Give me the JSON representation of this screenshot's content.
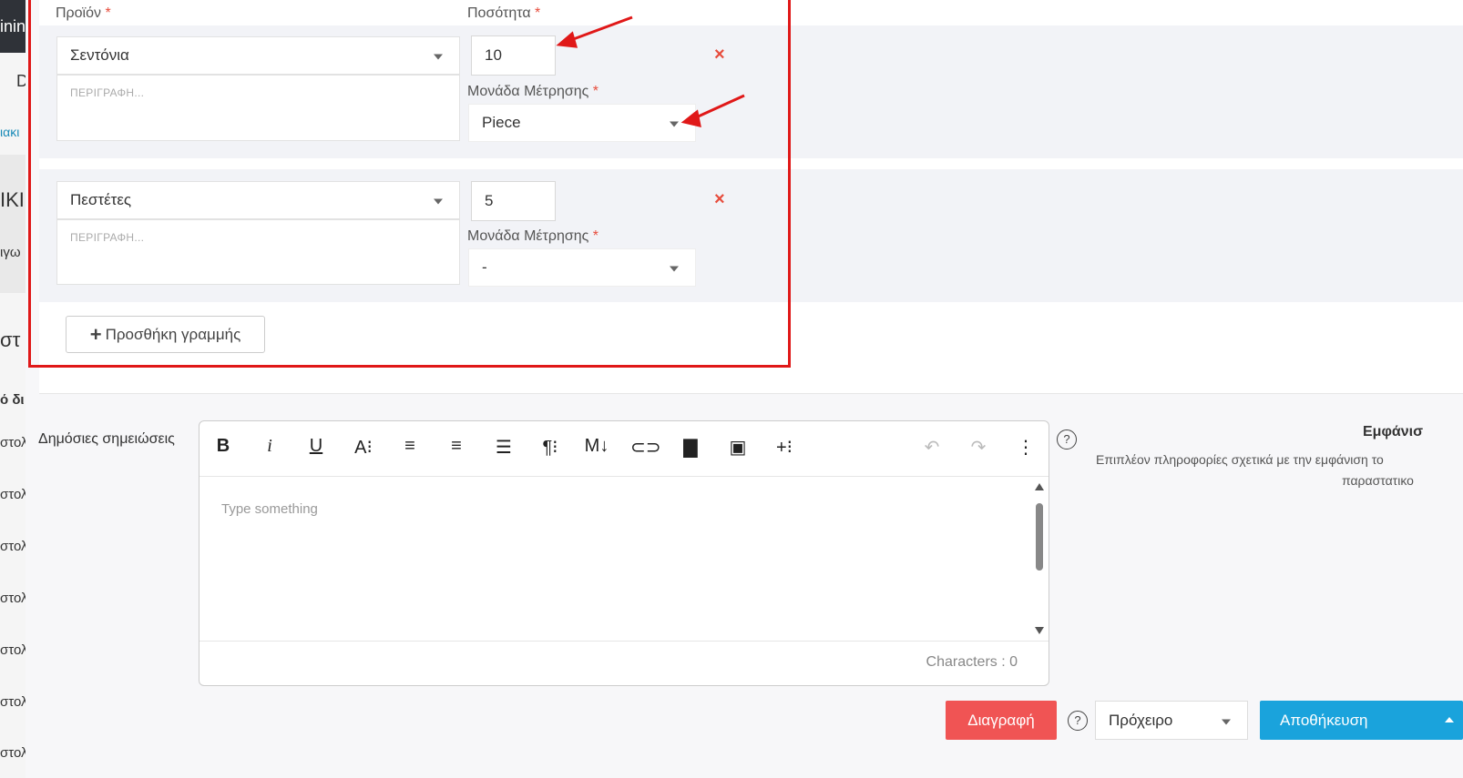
{
  "sidebar": {
    "fragments": [
      "inin",
      "D",
      "ιακι",
      "ΙΚΙ",
      "ιγω",
      "στ",
      "ό δι",
      "στολ",
      "στολ",
      "στολ",
      "στολ",
      "στολ",
      "στολ",
      "στολ"
    ]
  },
  "lines": {
    "product_label": "Προϊόν",
    "quantity_label": "Ποσότητα",
    "unit_label": "Μονάδα Μέτρησης",
    "required_mark": "*",
    "description_placeholder": "ΠΕΡΙΓΡΑΦΗ...",
    "remove_icon": "×",
    "rows": [
      {
        "product": "Σεντόνια",
        "quantity": "10",
        "unit": "Piece"
      },
      {
        "product": "Πεστέτες",
        "quantity": "5",
        "unit": "-"
      }
    ],
    "add_line_label": "Προσθήκη γραμμής",
    "add_line_icon": "+"
  },
  "notes": {
    "label": "Δημόσιες σημειώσεις",
    "placeholder": "Type something",
    "character_count": "Characters : 0",
    "toolbar_icons": [
      "B",
      "i",
      "U",
      "A⁝",
      "≡",
      "≡",
      "☰",
      "¶⁝",
      "M↓",
      "⊂⊃",
      "▇",
      "▣",
      "+⁝",
      "↶",
      "↷",
      "⋮"
    ]
  },
  "help_icon": "?",
  "appearance": {
    "title": "Εμφάνισ",
    "description_line1": "Επιπλέον πληροφορίες σχετικά με την εμφάνιση το",
    "description_line2": "παραστατικο"
  },
  "actions": {
    "delete_label": "Διαγραφή",
    "status_value": "Πρόχειρο",
    "save_label": "Αποθήκευση"
  },
  "colors": {
    "danger": "#f05454",
    "primary": "#1aa3dc",
    "annotation": "#e01818"
  }
}
